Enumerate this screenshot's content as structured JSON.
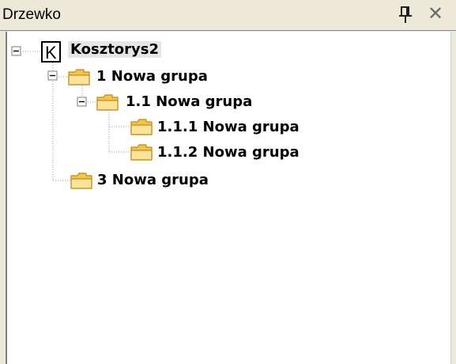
{
  "window": {
    "title": "Drzewko",
    "pin_icon": "pin-icon",
    "close_icon": "close-icon",
    "close_glyph": "✕"
  },
  "tree": {
    "root": {
      "letter": "K",
      "label": "Kosztorys2",
      "expanded": true
    },
    "nodes": [
      {
        "label": "1 Nowa grupa",
        "level": 1,
        "expanded": true
      },
      {
        "label": "1.1 Nowa grupa",
        "level": 2,
        "expanded": true
      },
      {
        "label": "1.1.1 Nowa grupa",
        "level": 3
      },
      {
        "label": "1.1.2 Nowa grupa",
        "level": 3
      },
      {
        "label": "3 Nowa grupa",
        "level": 1
      }
    ]
  },
  "colors": {
    "folder_fill": "#f6d36b",
    "folder_edge": "#c59a2a",
    "root_highlight": "#e6e6e6"
  }
}
